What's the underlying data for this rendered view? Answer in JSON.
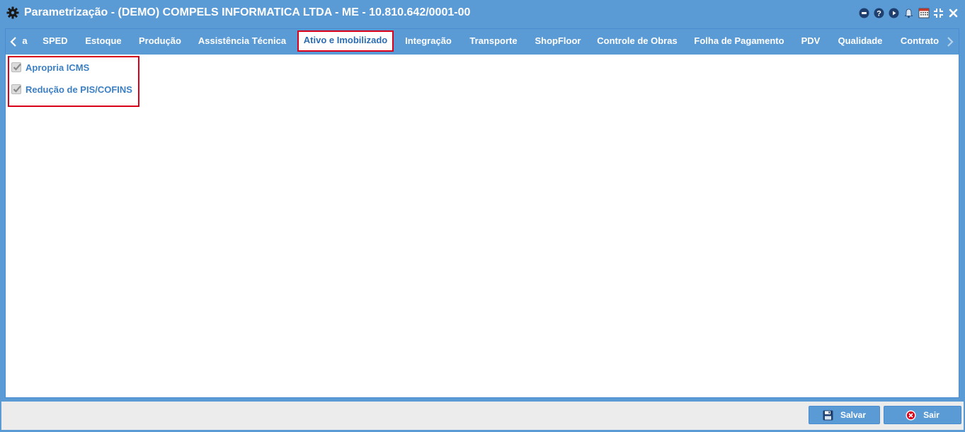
{
  "window": {
    "title": "Parametrização - (DEMO) COMPELS INFORMATICA LTDA - ME - 10.810.642/0001-00"
  },
  "tabs": [
    {
      "label": "a"
    },
    {
      "label": "SPED"
    },
    {
      "label": "Estoque"
    },
    {
      "label": "Produção"
    },
    {
      "label": "Assistência Técnica"
    },
    {
      "label": "Ativo e Imobilizado",
      "active": true
    },
    {
      "label": "Integração"
    },
    {
      "label": "Transporte"
    },
    {
      "label": "ShopFloor"
    },
    {
      "label": "Controle de Obras"
    },
    {
      "label": "Folha de Pagamento"
    },
    {
      "label": "PDV"
    },
    {
      "label": "Qualidade"
    },
    {
      "label": "Contrato"
    }
  ],
  "options": [
    {
      "label": "Apropria ICMS",
      "checked": true
    },
    {
      "label": "Redução de PIS/COFINS",
      "checked": true
    }
  ],
  "footer": {
    "save_label": "Salvar",
    "exit_label": "Sair"
  },
  "colors": {
    "primary": "#5b9bd5",
    "highlight": "#d9001b",
    "label": "#3c7fc3"
  }
}
